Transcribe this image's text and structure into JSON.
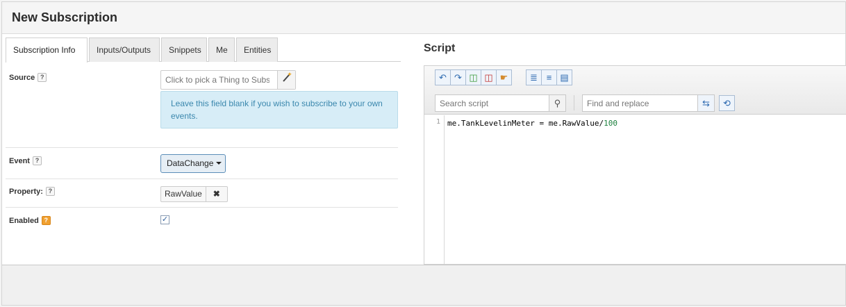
{
  "dialog": {
    "title": "New Subscription"
  },
  "tabs": [
    {
      "label": "Subscription Info",
      "active": true
    },
    {
      "label": "Inputs/Outputs"
    },
    {
      "label": "Snippets"
    },
    {
      "label": "Me"
    },
    {
      "label": "Entities"
    }
  ],
  "form": {
    "source": {
      "label": "Source",
      "help": "?",
      "placeholder": "Click to pick a Thing to Subscribe",
      "info": "Leave this field blank if you wish to subscribe to your own events."
    },
    "event": {
      "label": "Event",
      "help": "?",
      "value": "DataChange"
    },
    "property": {
      "label": "Property:",
      "help": "?",
      "value": "RawValue",
      "clear_icon": "close-icon"
    },
    "enabled": {
      "label": "Enabled",
      "help": "?",
      "checked": true,
      "check_mark": "✓"
    }
  },
  "script": {
    "title": "Script",
    "search_placeholder": "Search script",
    "replace_placeholder": "Find and replace",
    "line_number": "1",
    "code_before": "me.TankLevelinMeter = me.RawValue/",
    "code_number": "100"
  },
  "colors": {
    "info_bg": "#d7edf7",
    "info_text": "#3a87ad",
    "enabled_help": "#f0a030",
    "number_literal": "#1a7f3c"
  }
}
